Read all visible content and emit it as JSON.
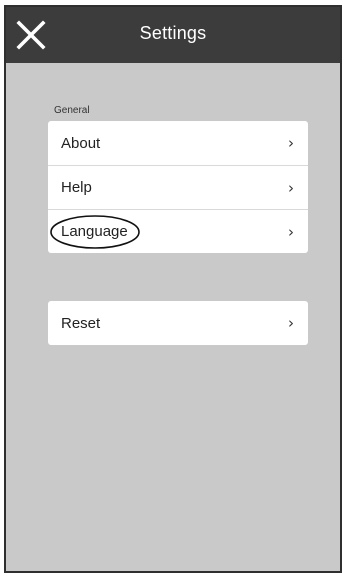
{
  "header": {
    "title": "Settings",
    "close_icon": "close-icon"
  },
  "general": {
    "section_label": "General",
    "items": [
      {
        "label": "About",
        "chevron": "›"
      },
      {
        "label": "Help",
        "chevron": "›"
      },
      {
        "label": "Language",
        "chevron": "›",
        "circled": true
      }
    ]
  },
  "reset": {
    "items": [
      {
        "label": "Reset",
        "chevron": "›"
      }
    ]
  },
  "colors": {
    "header_bg": "#3c3c3c",
    "page_bg": "#c9c9c9",
    "card_bg": "#ffffff"
  }
}
